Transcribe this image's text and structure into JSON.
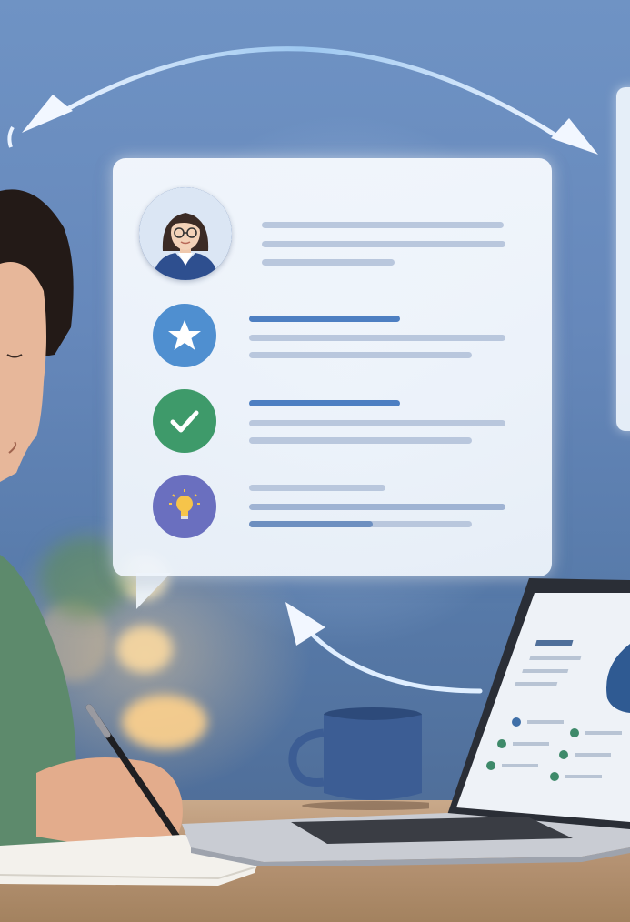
{
  "scene": {
    "description_free": true,
    "colors": {
      "card_background": "#f1f6fc",
      "accent_blue": "#4d7fc2",
      "star_badge": "#4f8fd0",
      "check_badge": "#3e9a6a",
      "idea_badge": "#6a6fbf",
      "avatar_bg": "#5f7fb3",
      "mug": "#3c5d94",
      "sweater": "#5d8a6c"
    }
  },
  "card": {
    "rows": [
      {
        "icon": "person-avatar-icon"
      },
      {
        "icon": "star-icon"
      },
      {
        "icon": "checkmark-icon"
      },
      {
        "icon": "lightbulb-icon"
      }
    ]
  },
  "laptop_screen": {
    "icons": [
      "pie-chart-icon"
    ]
  }
}
